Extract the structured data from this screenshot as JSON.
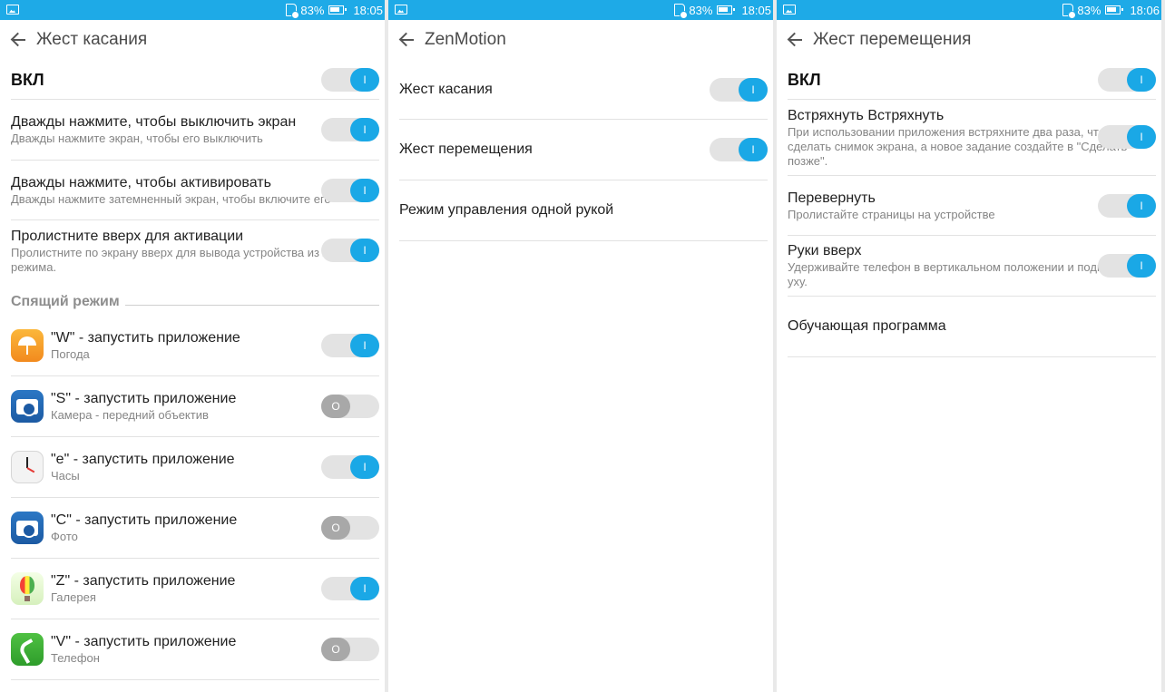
{
  "status": {
    "battery": "83%",
    "time": [
      "18:05",
      "18:05",
      "18:06"
    ]
  },
  "panels": [
    {
      "title": "Жест касания",
      "on_label": "ВКЛ",
      "items": [
        {
          "title": "Дважды нажмите, чтобы выключить экран",
          "subtitle": "Дважды нажмите экран, чтобы его выключить",
          "state": "on",
          "state_glyph": "I"
        },
        {
          "title": "Дважды нажмите, чтобы активировать",
          "subtitle": "Дважды нажмите затемненный экран, чтобы включите его",
          "state": "on",
          "state_glyph": "I"
        },
        {
          "title": "Пролистните вверх для активации",
          "subtitle": "Пролистните по экрану вверх для вывода устройства из ждущего режима.",
          "state": "on",
          "state_glyph": "I"
        }
      ],
      "section": "Спящий режим",
      "apps": [
        {
          "title": "\"W\" - запустить приложение",
          "subtitle": "Погода",
          "icon": "weather-icon",
          "state": "on",
          "state_glyph": "I"
        },
        {
          "title": "\"S\" - запустить приложение",
          "subtitle": "Камера - передний объектив",
          "icon": "camera-icon",
          "state": "off",
          "state_glyph": "O"
        },
        {
          "title": "\"e\" - запустить приложение",
          "subtitle": "Часы",
          "icon": "clock-icon",
          "state": "on",
          "state_glyph": "I"
        },
        {
          "title": "\"C\" - запустить приложение",
          "subtitle": "Фото",
          "icon": "camera-icon",
          "state": "off",
          "state_glyph": "O"
        },
        {
          "title": "\"Z\" - запустить приложение",
          "subtitle": "Галерея",
          "icon": "gallery-icon",
          "state": "on",
          "state_glyph": "I"
        },
        {
          "title": "\"V\" - запустить приложение",
          "subtitle": "Телефон",
          "icon": "phone-icon",
          "state": "off",
          "state_glyph": "O"
        }
      ]
    },
    {
      "title": "ZenMotion",
      "items": [
        {
          "title": "Жест касания",
          "state": "on",
          "state_glyph": "I"
        },
        {
          "title": "Жест перемещения",
          "state": "on",
          "state_glyph": "I"
        },
        {
          "title": "Режим управления одной рукой"
        }
      ]
    },
    {
      "title": "Жест перемещения",
      "on_label": "ВКЛ",
      "items": [
        {
          "title": "Встряхнуть Встряхнуть",
          "subtitle": "При использовании приложения встряхните два раза, чтобы сделать снимок экрана, а новое задание создайте в \"Сделать позже\".",
          "state": "on",
          "state_glyph": "I"
        },
        {
          "title": "Перевернуть",
          "subtitle": "Пролистайте страницы на устройстве",
          "state": "on",
          "state_glyph": "I"
        },
        {
          "title": "Руки вверх",
          "subtitle": "Удерживайте телефон в вертикальном положении и поднимите к уху.",
          "state": "on",
          "state_glyph": "I"
        },
        {
          "title": "Обучающая программа"
        }
      ]
    }
  ],
  "colors": {
    "statusbar": "#1eaae7",
    "switch_on": "#1aa8e6",
    "switch_off": "#a8a8a8",
    "track": "#e3e3e3"
  }
}
